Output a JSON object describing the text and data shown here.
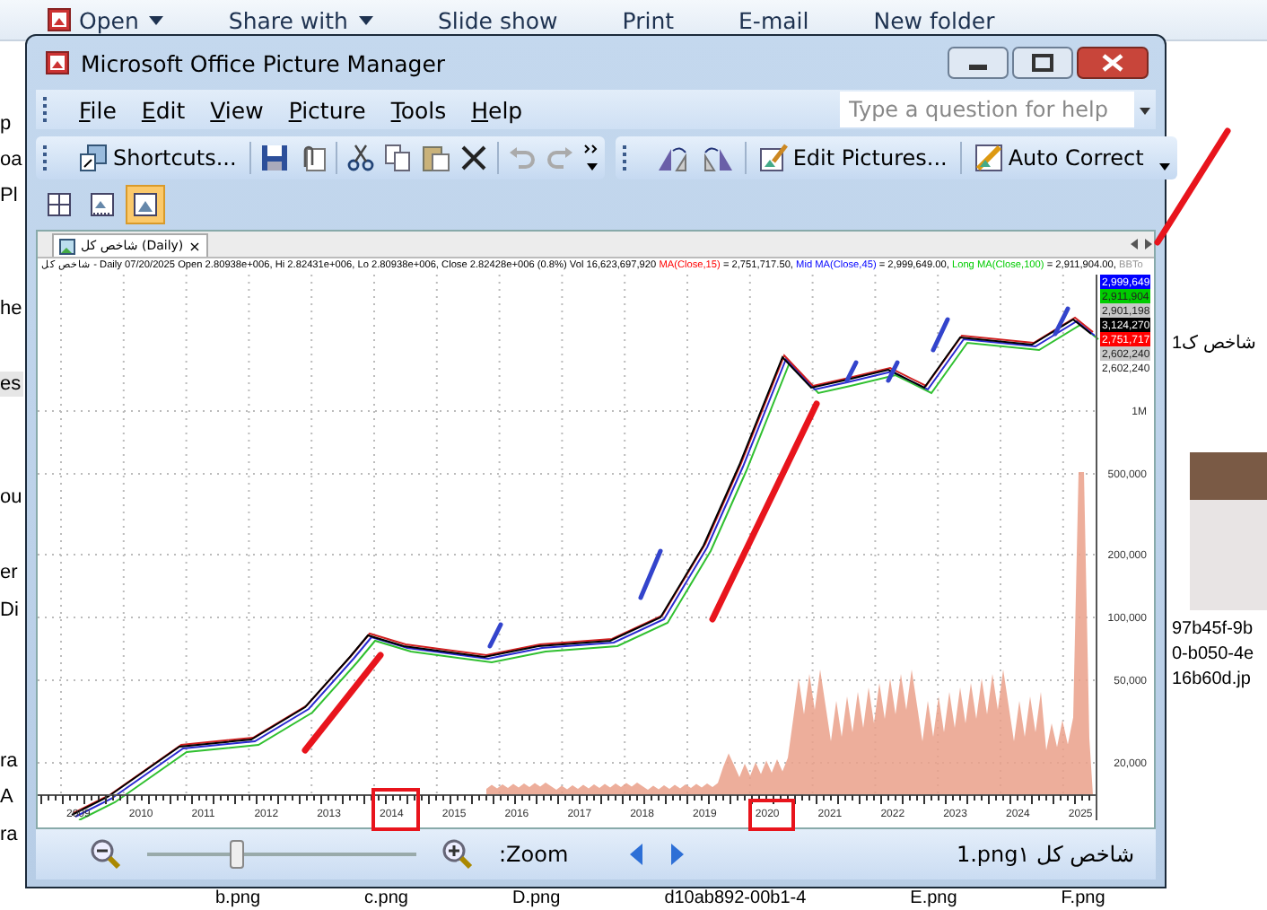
{
  "explorer": {
    "toolbar": [
      {
        "label": "Open",
        "dropdown": true
      },
      {
        "label": "Share with",
        "dropdown": true
      },
      {
        "label": "Slide show",
        "dropdown": false
      },
      {
        "label": "Print",
        "dropdown": false
      },
      {
        "label": "E-mail",
        "dropdown": false
      },
      {
        "label": "New folder",
        "dropdown": false
      }
    ],
    "left_labels": [
      {
        "text": "p",
        "selected": false
      },
      {
        "text": "oa",
        "selected": false
      },
      {
        "text": "Pl",
        "selected": false
      },
      {
        "text": "he",
        "selected": false
      },
      {
        "text": "es",
        "selected": true
      },
      {
        "text": "ou",
        "selected": false
      },
      {
        "text": "er",
        "selected": false
      },
      {
        "text": "Di",
        "selected": false
      },
      {
        "text": "ra",
        "selected": false
      },
      {
        "text": "A",
        "selected": false
      },
      {
        "text": "ra",
        "selected": false
      }
    ],
    "right_items": [
      {
        "kind": "caption",
        "text": "1شاخص ک"
      },
      {
        "kind": "photo"
      },
      {
        "kind": "caption",
        "text": "97b45f-9b"
      },
      {
        "kind": "caption",
        "text": "0-b050-4e"
      },
      {
        "kind": "caption",
        "text": "16b60d.jp"
      }
    ],
    "file_names": [
      "b.png",
      "c.png",
      "D.png",
      "d10ab892-00b1-4",
      "E.png",
      "F.png"
    ]
  },
  "window": {
    "title": "Microsoft Office Picture Manager",
    "menu": [
      "File",
      "Edit",
      "View",
      "Picture",
      "Tools",
      "Help"
    ],
    "help_placeholder": "Type a question for help",
    "toolbar_buttons": [
      "Shortcuts...",
      "Edit Pictures...",
      "Auto Correct"
    ],
    "view_buttons": [
      {
        "selected": false
      },
      {
        "selected": false
      },
      {
        "selected": true
      }
    ],
    "chart": {
      "tab": "شاخص کل (Daily)",
      "tab_close": "×",
      "header": [
        {
          "text": "شاخص کل - Daily 07/20/2025 Open 2.80938e+006, Hi 2.82431e+006, Lo 2.80938e+006, Close 2.82428e+006 (0.8%) Vol 16,623,697,920 ",
          "kind": "plain"
        },
        {
          "text": "MA(Close,15)",
          "kind": "short"
        },
        {
          "text": " = 2,751,717.50, ",
          "kind": "plain"
        },
        {
          "text": "Mid MA(Close,45)",
          "kind": "mid"
        },
        {
          "text": " = 2,999,649.00, ",
          "kind": "plain"
        },
        {
          "text": "Long MA(Close,100)",
          "kind": "long"
        },
        {
          "text": " = 2,911,904.00, ",
          "kind": "plain"
        },
        {
          "text": "BBTo",
          "kind": "band"
        }
      ],
      "price_tags": [
        {
          "text": "2,999,649",
          "color": "#0000ff"
        },
        {
          "text": "2,911,904",
          "color": "#00cc00"
        },
        {
          "text": "2,901,198",
          "color": "#c8c8c8"
        },
        {
          "text": "3,124,270",
          "color": "#000000"
        },
        {
          "text": "2,751,717",
          "color": "#ff0000"
        },
        {
          "text": "2,602,240",
          "color": "#c8c8c8"
        },
        {
          "text": "2,602,240"
        }
      ],
      "y_labels": [
        "1M",
        "500,000",
        "200,000",
        "100,000",
        "50,000",
        "20,000"
      ],
      "x_labels": [
        "2009",
        "2010",
        "2011",
        "2012",
        "2013",
        "2014",
        "2015",
        "2016",
        "2017",
        "2018",
        "2019",
        "2020",
        "2021",
        "2022",
        "2023",
        "2024",
        "2025"
      ]
    },
    "status": {
      "zoom_label": ":Zoom",
      "zoom": {
        "level": 0.33
      },
      "file_name": "1.pngشاخص کل ۱"
    }
  }
}
